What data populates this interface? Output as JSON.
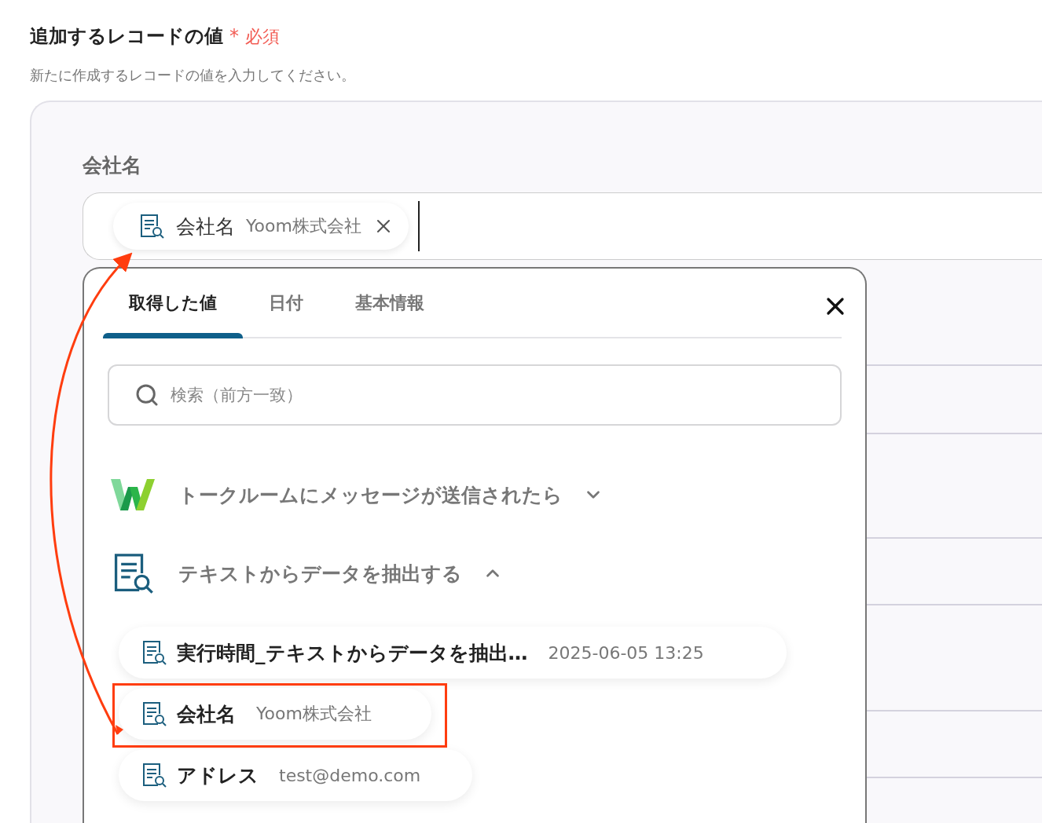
{
  "section": {
    "title": "追加するレコードの値",
    "required_mark": "*",
    "required_label": "必須",
    "description": "新たに作成するレコードの値を入力してください。"
  },
  "field": {
    "label": "会社名",
    "chips": [
      {
        "name": "会社名",
        "value": "Yoom株式会社"
      }
    ]
  },
  "picker": {
    "tabs": [
      {
        "label": "取得した値",
        "selected": true
      },
      {
        "label": "日付",
        "selected": false
      },
      {
        "label": "基本情報",
        "selected": false
      }
    ],
    "search": {
      "placeholder": "検索（前方一致）"
    },
    "groups": [
      {
        "kind": "app",
        "title": "トークルームにメッセージが送信されたら",
        "expanded": false
      },
      {
        "kind": "extract",
        "title": "テキストからデータを抽出する",
        "expanded": true,
        "items": [
          {
            "name": "実行時間_テキストからデータを抽出…",
            "value": "2025-06-05 13:25",
            "highlighted": false
          },
          {
            "name": "会社名",
            "value": "Yoom株式会社",
            "highlighted": true
          },
          {
            "name": "アドレス",
            "value": "test@demo.com",
            "highlighted": false
          }
        ]
      }
    ]
  }
}
